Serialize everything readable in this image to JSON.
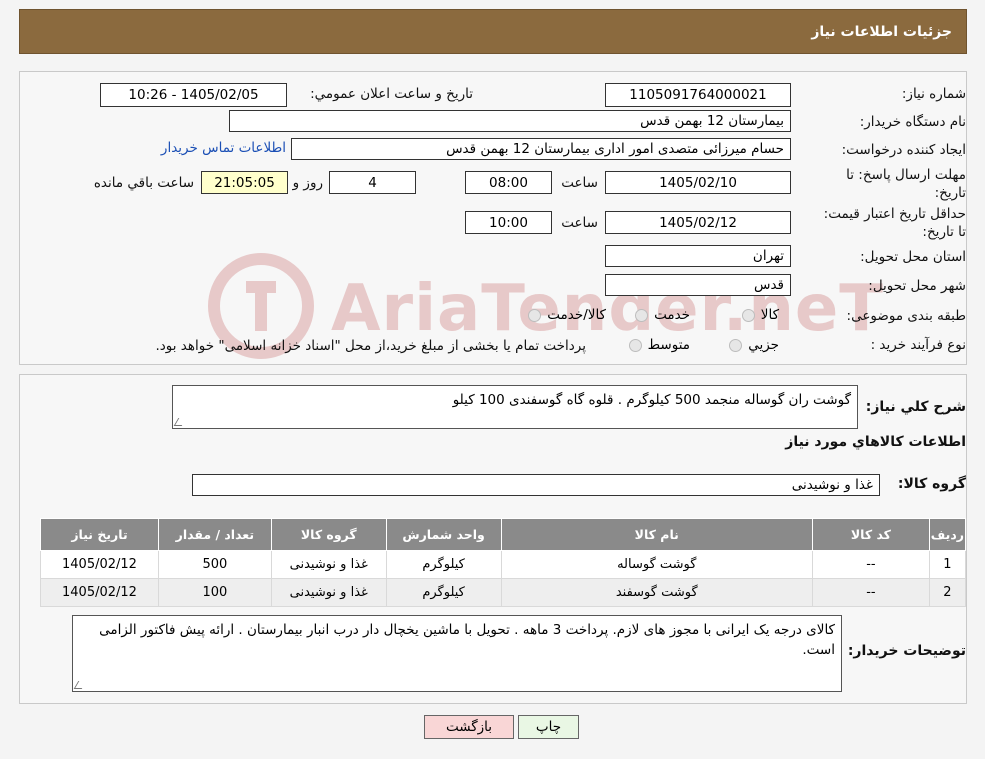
{
  "header": {
    "title": "جزئیات اطلاعات نیاز"
  },
  "details": {
    "need_number_label": "شماره نیاز:",
    "need_number": "1105091764000021",
    "announce_label": "تاریخ و ساعت اعلان عمومي:",
    "announce_value": "1405/02/05 - 10:26",
    "buyer_org_label": "نام دستگاه خریدار:",
    "buyer_org": "بیمارستان 12 بهمن قدس",
    "requester_label": "ایجاد کننده درخواست:",
    "requester": "حسام میرزائی متصدی امور اداری بیمارستان 12 بهمن قدس",
    "contact_link": "اطلاعات تماس خریدار",
    "deadline_label": "مهلت ارسال پاسخ: تا تاریخ:",
    "deadline_date": "1405/02/10",
    "time_label": "ساعت",
    "deadline_time": "08:00",
    "days_value": "4",
    "days_label": "روز و",
    "remaining_time": "21:05:05",
    "remaining_label": "ساعت باقي مانده",
    "validity_label": "حداقل تاریخ اعتبار قیمت: تا تاریخ:",
    "validity_date": "1405/02/12",
    "validity_time": "10:00",
    "province_label": "استان محل تحویل:",
    "province": "تهران",
    "city_label": "شهر محل تحویل:",
    "city": "قدس",
    "category_label": "طبقه بندی موضوعی:",
    "category_options": [
      "کالا",
      "خدمت",
      "کالا/خدمت"
    ],
    "process_label": "نوع فرآیند خرید :",
    "process_options": [
      "جزيي",
      "متوسط"
    ],
    "process_note": "پرداخت تمام یا بخشی از مبلغ خرید،از محل \"اسناد خزانه اسلامی\" خواهد بود."
  },
  "watermark": {
    "text": "AriaTender.neT"
  },
  "description": {
    "label": "شرح کلي نياز:",
    "text": "گوشت ران گوساله منجمد 500 کیلوگرم . قلوه گاه گوسفندی 100 کیلو",
    "items_heading": "اطلاعات کالاهاي مورد نياز",
    "group_label": "گروه کالا:",
    "group_value": "غذا و نوشیدنی"
  },
  "table": {
    "columns": [
      "رديف",
      "کد کالا",
      "نام کالا",
      "واحد شمارش",
      "گروه کالا",
      "تعداد / مقدار",
      "تاریخ نیاز"
    ],
    "rows": [
      [
        "1",
        "--",
        "گوشت گوساله",
        "کیلوگرم",
        "غذا و نوشیدنی",
        "500",
        "1405/02/12"
      ],
      [
        "2",
        "--",
        "گوشت گوسفند",
        "کیلوگرم",
        "غذا و نوشیدنی",
        "100",
        "1405/02/12"
      ]
    ]
  },
  "buyer_notes": {
    "label": "توضیحات خریدار:",
    "text": "کالای درجه یک ایرانی با مجوز های لازم. پرداخت 3 ماهه . تحویل با ماشین یخچال دار درب انبار بیمارستان . ارائه پیش فاکتور الزامی است."
  },
  "buttons": {
    "print": "چاپ",
    "back": "بازگشت"
  }
}
